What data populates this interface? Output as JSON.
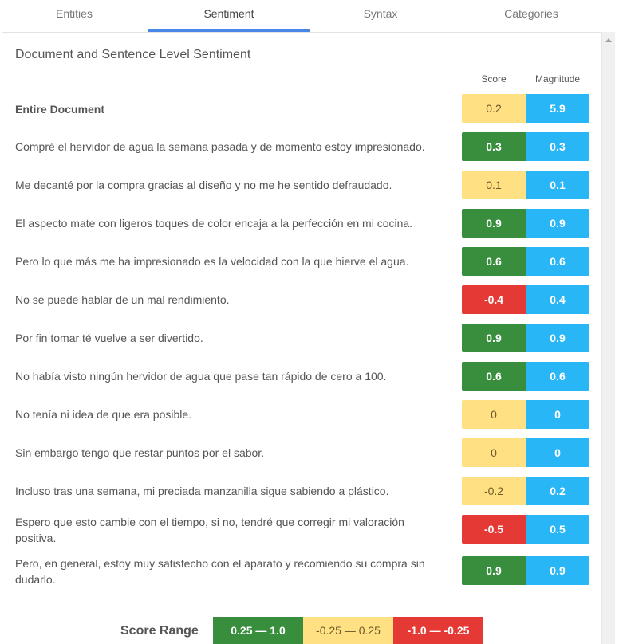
{
  "tabs": [
    {
      "label": "Entities",
      "active": false
    },
    {
      "label": "Sentiment",
      "active": true
    },
    {
      "label": "Syntax",
      "active": false
    },
    {
      "label": "Categories",
      "active": false
    }
  ],
  "panel": {
    "title": "Document and Sentence Level Sentiment",
    "columns": {
      "score": "Score",
      "magnitude": "Magnitude"
    },
    "document": {
      "label": "Entire Document",
      "score": "0.2",
      "magnitude": "5.9",
      "class": "neutral"
    },
    "sentences": [
      {
        "text": "Compré el hervidor de agua la semana pasada y de momento estoy impresionado.",
        "score": "0.3",
        "magnitude": "0.3",
        "class": "positive"
      },
      {
        "text": "Me decanté por la compra gracias al diseño y no me he sentido defraudado.",
        "score": "0.1",
        "magnitude": "0.1",
        "class": "neutral"
      },
      {
        "text": "El aspecto mate con ligeros toques de color encaja a la perfección en mi cocina.",
        "score": "0.9",
        "magnitude": "0.9",
        "class": "positive"
      },
      {
        "text": "Pero lo que más me ha impresionado es la velocidad con la que hierve el agua.",
        "score": "0.6",
        "magnitude": "0.6",
        "class": "positive"
      },
      {
        "text": "No se puede hablar de un mal rendimiento.",
        "score": "-0.4",
        "magnitude": "0.4",
        "class": "negative"
      },
      {
        "text": "Por fin tomar té vuelve a ser divertido.",
        "score": "0.9",
        "magnitude": "0.9",
        "class": "positive"
      },
      {
        "text": "No había visto ningún hervidor de agua que pase tan rápido de cero a 100.",
        "score": "0.6",
        "magnitude": "0.6",
        "class": "positive"
      },
      {
        "text": "No tenía ni idea de que era posible.",
        "score": "0",
        "magnitude": "0",
        "class": "neutral"
      },
      {
        "text": "Sin embargo tengo que restar puntos por el sabor.",
        "score": "0",
        "magnitude": "0",
        "class": "neutral"
      },
      {
        "text": "Incluso tras una semana, mi preciada manzanilla sigue sabiendo a plástico.",
        "score": "-0.2",
        "magnitude": "0.2",
        "class": "neutral"
      },
      {
        "text": "Espero que esto cambie con el tiempo, si no, tendré que corregir mi valoración positiva.",
        "score": "-0.5",
        "magnitude": "0.5",
        "class": "negative"
      },
      {
        "text": "Pero, en general, estoy muy satisfecho con el aparato y recomiendo su compra sin dudarlo.",
        "score": "0.9",
        "magnitude": "0.9",
        "class": "positive"
      }
    ]
  },
  "legend": {
    "label": "Score Range",
    "positive": "0.25 — 1.0",
    "neutral": "-0.25 — 0.25",
    "negative": "-1.0 — -0.25"
  },
  "colors": {
    "positive": "#388e3c",
    "neutral": "#ffe082",
    "negative": "#e53935",
    "magnitude": "#29b6f6",
    "tab_indicator": "#4a86e8"
  }
}
